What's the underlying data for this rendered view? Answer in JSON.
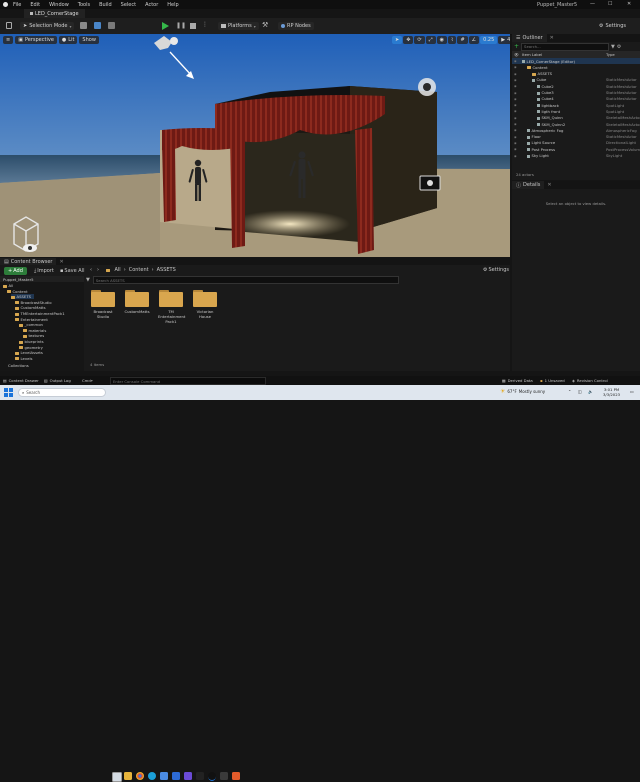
{
  "window": {
    "project_name": "Puppet_Master5"
  },
  "menu": [
    "File",
    "Edit",
    "Window",
    "Tools",
    "Build",
    "Select",
    "Actor",
    "Help"
  ],
  "level_tab": "LED_CornerStage",
  "toolbar": {
    "mode": "Selection Mode",
    "platforms": "Platforms",
    "nodes": "RP Nodes",
    "settings": "Settings"
  },
  "viewport": {
    "perspective": "Perspective",
    "lit": "Lit",
    "show": "Show",
    "fov": "0.25",
    "num": "4"
  },
  "outliner": {
    "tab": "Outliner",
    "search_placeholder": "Search...",
    "col_label": "Item Label",
    "col_type": "Type",
    "rows": [
      {
        "label": "LED_CornerStage (Editor)",
        "type": "",
        "indent": 0,
        "kind": "level"
      },
      {
        "label": "Content",
        "type": "",
        "indent": 1,
        "kind": "folder"
      },
      {
        "label": "ASSETS",
        "type": "",
        "indent": 2,
        "kind": "folder"
      },
      {
        "label": "Cube",
        "type": "StaticMeshActor",
        "indent": 2,
        "kind": "cube"
      },
      {
        "label": "Cube2",
        "type": "StaticMeshActor",
        "indent": 3,
        "kind": "cube"
      },
      {
        "label": "Cube3",
        "type": "StaticMeshActor",
        "indent": 3,
        "kind": "cube"
      },
      {
        "label": "Cube4",
        "type": "StaticMeshActor",
        "indent": 3,
        "kind": "cube"
      },
      {
        "label": "lightback",
        "type": "SpotLight",
        "indent": 3,
        "kind": "cube"
      },
      {
        "label": "ligth front",
        "type": "SpotLight",
        "indent": 3,
        "kind": "cube"
      },
      {
        "label": "SKM_Quinn",
        "type": "SkeletalMeshActor",
        "indent": 3,
        "kind": "cube"
      },
      {
        "label": "SKM_Quinn2",
        "type": "SkeletalMeshActor",
        "indent": 3,
        "kind": "cube"
      },
      {
        "label": "Atmospheric Fog",
        "type": "AtmosphericFog",
        "indent": 1,
        "kind": "cube"
      },
      {
        "label": "Floor",
        "type": "StaticMeshActor",
        "indent": 1,
        "kind": "cube"
      },
      {
        "label": "Light Source",
        "type": "DirectionalLight",
        "indent": 1,
        "kind": "cube"
      },
      {
        "label": "Post Process",
        "type": "PostProcessVolume",
        "indent": 1,
        "kind": "cube"
      },
      {
        "label": "Sky Light",
        "type": "SkyLight",
        "indent": 1,
        "kind": "cube"
      }
    ],
    "count": "24 actors"
  },
  "details": {
    "tab": "Details",
    "empty_msg": "Select an object to view details."
  },
  "content_browser": {
    "tab": "Content Browser",
    "add": "Add",
    "import": "Import",
    "save_all": "Save All",
    "breadcrumb": [
      "All",
      "Content",
      "ASSETS"
    ],
    "settings": "Settings",
    "project": "Puppet_Master5",
    "search_placeholder": "Search ASSETS",
    "tree": [
      {
        "label": "All",
        "indent": 0
      },
      {
        "label": "Content",
        "indent": 1
      },
      {
        "label": "ASSETS",
        "indent": 2
      },
      {
        "label": "BroadcastStudio",
        "indent": 3
      },
      {
        "label": "CustomMatts",
        "indent": 3
      },
      {
        "label": "TMEntertainmentPack1",
        "indent": 3
      },
      {
        "label": "Entertainment",
        "indent": 3
      },
      {
        "label": "_common",
        "indent": 4
      },
      {
        "label": "materials",
        "indent": 5
      },
      {
        "label": "textures",
        "indent": 5
      },
      {
        "label": "blueprints",
        "indent": 4
      },
      {
        "label": "geometry",
        "indent": 4
      },
      {
        "label": "LevelAssets",
        "indent": 3
      },
      {
        "label": "Levels",
        "indent": 3
      }
    ],
    "collections": "Collections",
    "assets": [
      {
        "name": "Broadcast Studio"
      },
      {
        "name": "CustomMatts"
      },
      {
        "name": "TM Entertainment Pack1"
      },
      {
        "name": "Victorian House"
      }
    ],
    "item_count": "4 items"
  },
  "statusbar": {
    "content_drawer": "Content Drawer",
    "output_log": "Output Log",
    "cmd": "Cmd",
    "console_placeholder": "Enter Console Command",
    "derived_data": "Derived Data",
    "unsaved": "1 Unsaved",
    "revision": "Revision Control"
  },
  "taskbar": {
    "search_placeholder": "Search",
    "weather_temp": "67°F",
    "weather_desc": "Mostly sunny",
    "time": "3:01 PM",
    "date": "3/3/2023"
  },
  "colors": {
    "accent": "#2a7bd0",
    "play": "#35b84a",
    "folder": "#d9a64e"
  }
}
